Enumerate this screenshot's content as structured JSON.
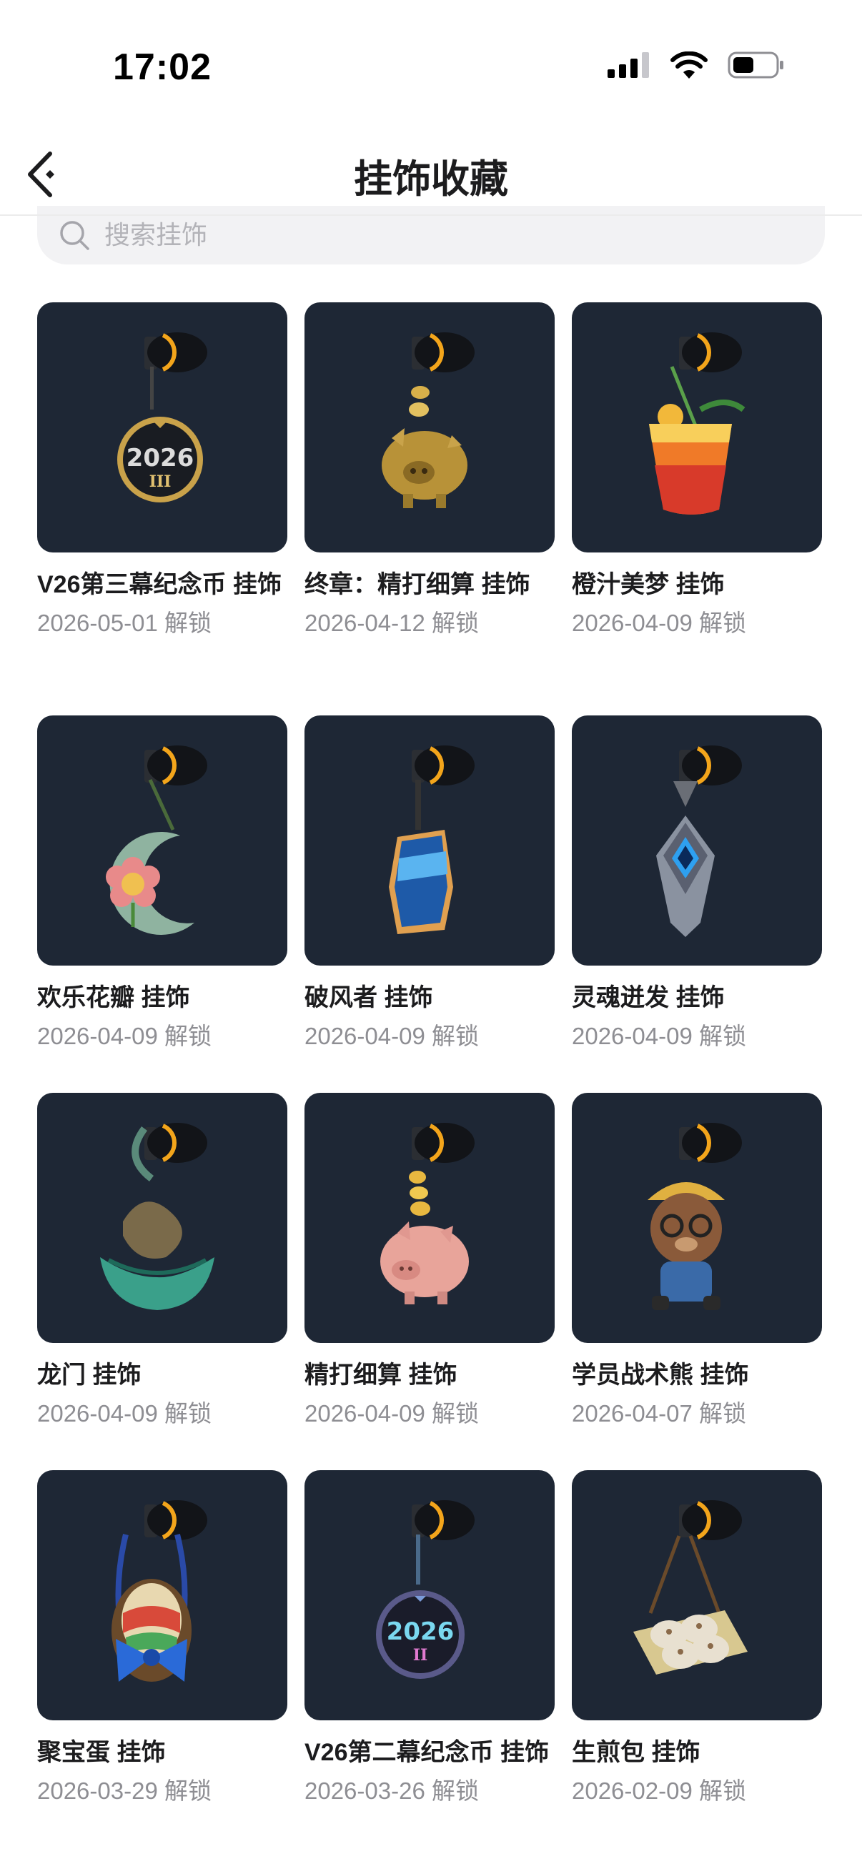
{
  "status_bar": {
    "time": "17:02"
  },
  "nav": {
    "title": "挂饰收藏"
  },
  "search": {
    "placeholder": "搜索挂饰",
    "value": ""
  },
  "items": [
    {
      "name": "V26第三幕纪念币 挂饰",
      "date": "2026-05-01 解锁",
      "icon": "coin-2026-iii-charm",
      "badge_text": "2026",
      "badge_sub": "III"
    },
    {
      "name": "终章：精打细算 挂饰",
      "date": "2026-04-12 解锁",
      "icon": "golden-pig-charm"
    },
    {
      "name": "橙汁美梦 挂饰",
      "date": "2026-04-09 解锁",
      "icon": "orange-juice-charm"
    },
    {
      "name": "欢乐花瓣 挂饰",
      "date": "2026-04-09 解锁",
      "icon": "flower-moon-charm"
    },
    {
      "name": "破风者 挂饰",
      "date": "2026-04-09 解锁",
      "icon": "blue-visor-charm"
    },
    {
      "name": "灵魂迸发 挂饰",
      "date": "2026-04-09 解锁",
      "icon": "soul-crystal-charm"
    },
    {
      "name": "龙门 挂饰",
      "date": "2026-04-09 解锁",
      "icon": "dragon-gate-charm"
    },
    {
      "name": "精打细算 挂饰",
      "date": "2026-04-09 解锁",
      "icon": "pink-pig-charm"
    },
    {
      "name": "学员战术熊 挂饰",
      "date": "2026-04-07 解锁",
      "icon": "tactical-bear-charm"
    },
    {
      "name": "聚宝蛋 挂饰",
      "date": "2026-03-29 解锁",
      "icon": "treasure-egg-charm"
    },
    {
      "name": "V26第二幕纪念币 挂饰",
      "date": "2026-03-26 解锁",
      "icon": "coin-2026-ii-charm",
      "badge_text": "2026",
      "badge_sub": "II"
    },
    {
      "name": "生煎包 挂饰",
      "date": "2026-02-09 解锁",
      "icon": "fried-bun-charm"
    }
  ],
  "colors": {
    "thumb_bg": "#1e2735",
    "date_text": "#8e8e93",
    "search_bg": "#f2f2f4"
  }
}
